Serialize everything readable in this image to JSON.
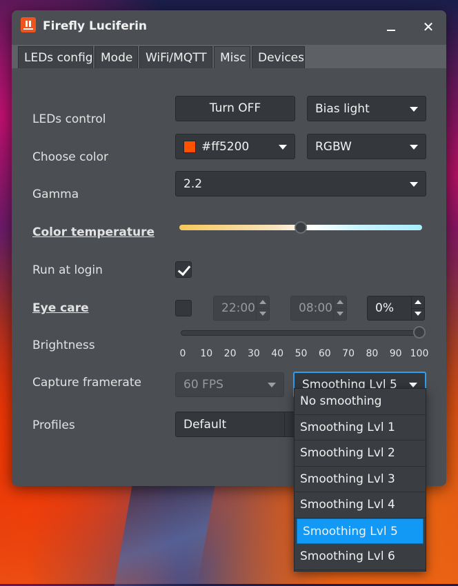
{
  "window": {
    "title": "Firefly Luciferin",
    "minimize_icon": "minimize-icon",
    "close_label": "✕"
  },
  "tabs": [
    {
      "label": "LEDs config"
    },
    {
      "label": "Mode"
    },
    {
      "label": "WiFi/MQTT"
    },
    {
      "label": "Misc",
      "active": true
    },
    {
      "label": "Devices"
    }
  ],
  "rows": {
    "leds_control": {
      "label": "LEDs control",
      "button": "Turn OFF",
      "effect": "Bias light"
    },
    "choose_color": {
      "label": "Choose color",
      "color_value": "#ff5200",
      "swatch": "#ff5200",
      "color_mode": "RGBW"
    },
    "gamma": {
      "label": "Gamma",
      "value": "2.2"
    },
    "color_temperature": {
      "label": "Color temperature",
      "level_fraction": 0.5
    },
    "run_at_login": {
      "label": "Run at login",
      "checked": true
    },
    "eye_care": {
      "label": "Eye care",
      "checked": false,
      "start": "22:00",
      "end": "08:00",
      "percent": "0%"
    },
    "brightness": {
      "label": "Brightness",
      "value": 100,
      "ticks": [
        "0",
        "10",
        "20",
        "30",
        "40",
        "50",
        "60",
        "70",
        "80",
        "90",
        "100"
      ]
    },
    "capture_framerate": {
      "label": "Capture framerate",
      "fps": "60 FPS",
      "smoothing": "Smoothing Lvl 5"
    },
    "profiles": {
      "label": "Profiles",
      "value": "Default"
    }
  },
  "smoothing_options": [
    "No smoothing",
    "Smoothing Lvl 1",
    "Smoothing Lvl 2",
    "Smoothing Lvl 3",
    "Smoothing Lvl 4",
    "Smoothing Lvl 5",
    "Smoothing Lvl 6"
  ],
  "selected_smoothing_index": 5,
  "colors": {
    "accent": "#1199f5",
    "logo": "#f0541d"
  }
}
